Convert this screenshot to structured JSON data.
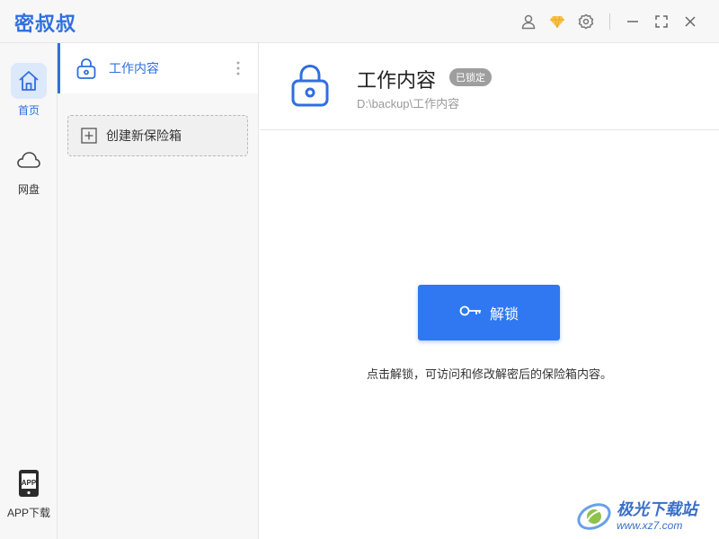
{
  "app": {
    "title": "密叔叔",
    "accent": "#2f6fe0"
  },
  "titlebar": {
    "icons": [
      "user-icon",
      "diamond-icon",
      "gear-icon",
      "minimize-icon",
      "maximize-icon",
      "close-icon"
    ]
  },
  "nav": {
    "items": [
      {
        "label": "首页",
        "icon": "home-icon",
        "active": true
      },
      {
        "label": "网盘",
        "icon": "cloud-icon",
        "active": false
      },
      {
        "label": "APP下载",
        "icon": "app-download-icon",
        "active": false
      }
    ]
  },
  "vaults": {
    "items": [
      {
        "label": "工作内容",
        "icon": "lock-icon",
        "selected": true
      }
    ],
    "create_label": "创建新保险箱"
  },
  "main": {
    "title": "工作内容",
    "badge": "已锁定",
    "path": "D:\\backup\\工作内容",
    "unlock_label": "解锁",
    "hint": "点击解锁，可访问和修改解密后的保险箱内容。"
  },
  "watermark": {
    "name": "极光下载站",
    "url": "www.xz7.com"
  }
}
